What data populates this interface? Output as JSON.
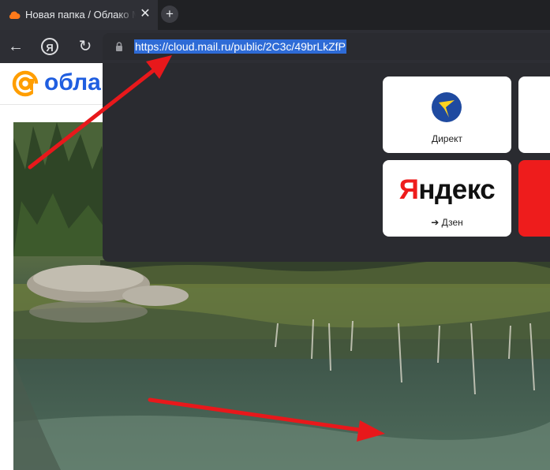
{
  "browser": {
    "tab": {
      "title": "Новая папка / Облако Mail",
      "close_icon": "close-icon",
      "favicon": "cloud-icon"
    },
    "new_tab_symbol": "+",
    "toolbar": {
      "back_symbol": "←",
      "yandex_symbol": "Я",
      "reload_symbol": "↻"
    },
    "address_bar": {
      "url": "https://cloud.mail.ru/public/2C3c/49brLkZfP",
      "selected": true,
      "lock_icon": "lock-icon"
    }
  },
  "page": {
    "logo_text": "облако"
  },
  "dropdown": {
    "tiles": [
      {
        "label": "Директ"
      },
      {
        "logo_first": "Я",
        "logo_rest": "ндекс",
        "label": "➔ Дзен"
      }
    ]
  },
  "colors": {
    "url_selection": "#2e6bd6",
    "arrow": "#e8181b",
    "brand_orange": "#ff9e00",
    "brand_blue": "#1f5ee0",
    "yandex_red": "#ee1c1c"
  }
}
